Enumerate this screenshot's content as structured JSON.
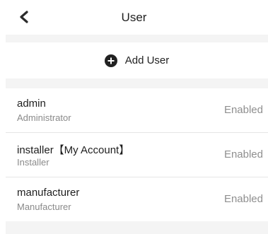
{
  "header": {
    "title": "User",
    "back_icon": "back-chevron-icon"
  },
  "add_user": {
    "label": "Add User",
    "icon": "plus-circle-icon",
    "icon_color": "#222222"
  },
  "users": [
    {
      "name": "admin",
      "role": "Administrator",
      "status": "Enabled"
    },
    {
      "name": "installer【My Account】",
      "role": "Installer",
      "status": "Enabled"
    },
    {
      "name": "manufacturer",
      "role": "Manufacturer",
      "status": "Enabled"
    }
  ],
  "colors": {
    "background_gap": "#f4f4f4",
    "divider": "#e6e6e6",
    "secondary_text": "#8a8a8a"
  }
}
